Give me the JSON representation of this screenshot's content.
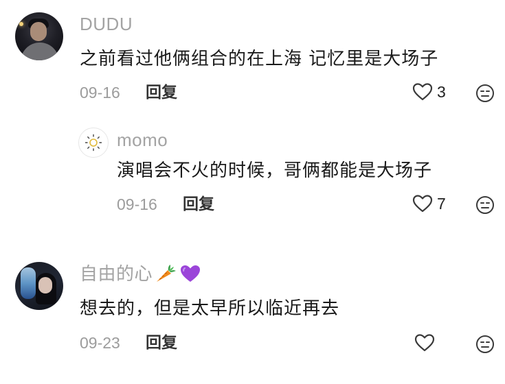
{
  "comments": [
    {
      "username": "DUDU",
      "text": "之前看过他俩组合的在上海 记忆里是大场子",
      "date": "09-16",
      "reply_label": "回复",
      "likes": "3"
    },
    {
      "username": "momo",
      "text": "演唱会不火的时候，哥俩都能是大场子",
      "date": "09-16",
      "reply_label": "回复",
      "likes": "7"
    },
    {
      "username": "自由的心",
      "username_emojis": [
        "carrot-icon",
        "purple-heart-icon"
      ],
      "text": "想去的，但是太早所以临近再去",
      "date": "09-23",
      "reply_label": "回复",
      "likes": ""
    }
  ],
  "colors": {
    "username": "#a3a3a3",
    "text": "#1a1a1a",
    "date": "#9c9c9c",
    "icon_stroke": "#3a3a3a"
  }
}
